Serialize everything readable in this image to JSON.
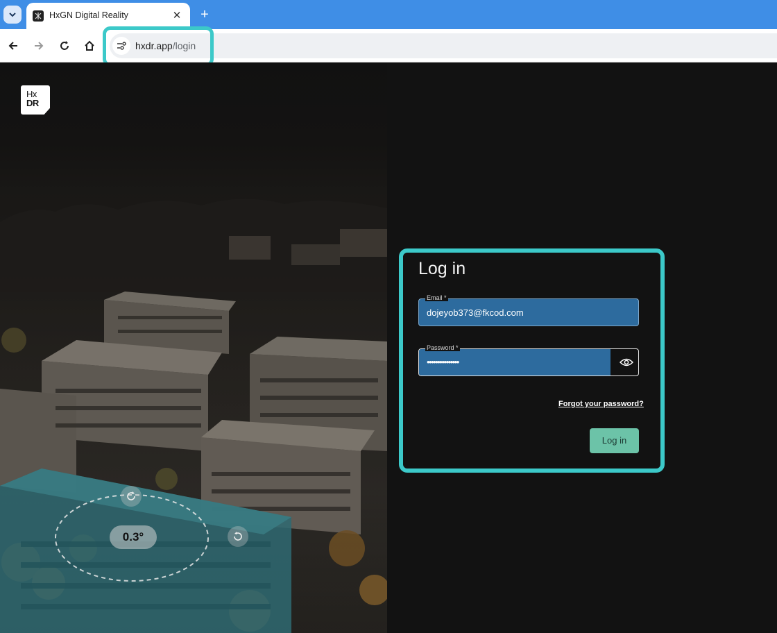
{
  "browser": {
    "tab_title": "HxGN Digital Reality",
    "tab_close": "✕",
    "new_tab": "+",
    "url_host": "hxdr.app",
    "url_path": "/login"
  },
  "page": {
    "logo_text_top": "Hx",
    "logo_text_bottom": "DR",
    "login": {
      "title": "Log in",
      "email_label": "Email *",
      "email_value": "dojeyob373@fkcod.com",
      "password_label": "Password *",
      "password_value": "•••••••••••••••",
      "forgot_label": "Forgot your password?",
      "submit_label": "Log in"
    },
    "map_overlay": {
      "rotation_readout": "0.3°"
    }
  },
  "colors": {
    "highlight": "#3cc9c9",
    "field_fill": "#2d6b9e",
    "button": "#6cc3a8",
    "tabbar": "#3f8ee6"
  },
  "icons": [
    "tab-search-icon",
    "favicon-icon",
    "close-icon",
    "plus-icon",
    "back-arrow-icon",
    "forward-arrow-icon",
    "reload-icon",
    "home-icon",
    "site-info-icon",
    "eye-icon",
    "rotate-icon"
  ]
}
